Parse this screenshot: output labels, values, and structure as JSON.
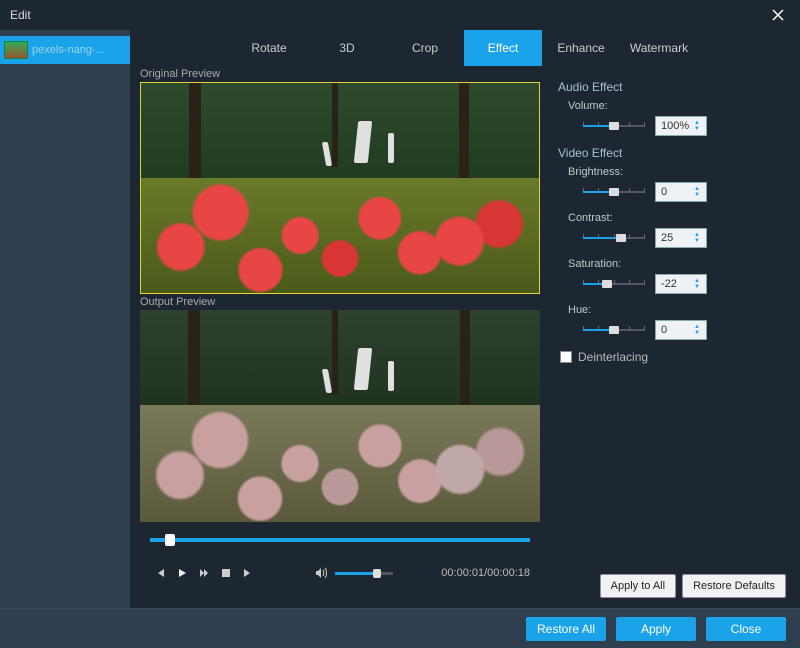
{
  "window": {
    "title": "Edit"
  },
  "sidebar": {
    "items": [
      {
        "label": "pexels-nang-..."
      }
    ]
  },
  "tabs": [
    {
      "label": "Rotate"
    },
    {
      "label": "3D"
    },
    {
      "label": "Crop"
    },
    {
      "label": "Effect"
    },
    {
      "label": "Enhance"
    },
    {
      "label": "Watermark"
    }
  ],
  "active_tab": "Effect",
  "preview": {
    "original_label": "Original Preview",
    "output_label": "Output Preview"
  },
  "playback": {
    "position_pct": 6,
    "volume_pct": 70,
    "timecode": "00:00:01/00:00:18"
  },
  "panel": {
    "audio_section": "Audio Effect",
    "video_section": "Video Effect",
    "volume_label": "Volume:",
    "volume_value": "100%",
    "brightness_label": "Brightness:",
    "brightness_value": "0",
    "contrast_label": "Contrast:",
    "contrast_value": "25",
    "saturation_label": "Saturation:",
    "saturation_value": "-22",
    "hue_label": "Hue:",
    "hue_value": "0",
    "deinterlacing_label": "Deinterlacing",
    "deinterlacing_checked": false
  },
  "buttons": {
    "apply_to_all": "Apply to All",
    "restore_defaults": "Restore Defaults",
    "restore_all": "Restore All",
    "apply": "Apply",
    "close": "Close"
  }
}
